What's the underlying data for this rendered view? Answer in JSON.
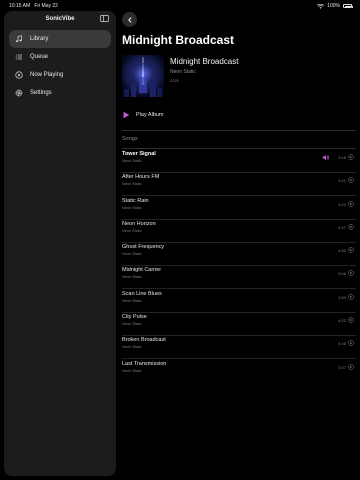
{
  "status_bar": {
    "time": "10:15 AM",
    "date": "Fri May 22",
    "battery": "100%",
    "battery_level": 1.0
  },
  "sidebar": {
    "app_title": "SonicVibe",
    "items": [
      {
        "label": "Library",
        "icon": "music-library-icon",
        "active": true
      },
      {
        "label": "Queue",
        "icon": "list-icon",
        "active": false
      },
      {
        "label": "Now Playing",
        "icon": "play-circle-icon",
        "active": false
      },
      {
        "label": "Settings",
        "icon": "gear-icon",
        "active": false
      }
    ]
  },
  "album": {
    "page_title": "Midnight Broadcast",
    "name": "Midnight Broadcast",
    "artist": "Neon Static",
    "year": "2026",
    "play_label": "Play Album"
  },
  "songs": {
    "header": "Songs",
    "accent_color": "#c65bd6",
    "items": [
      {
        "title": "Tower Signal",
        "artist": "Neon Static",
        "duration": "3:18",
        "playing": true
      },
      {
        "title": "After Hours FM",
        "artist": "Neon Static",
        "duration": "3:41",
        "playing": false
      },
      {
        "title": "Static Rain",
        "artist": "Neon Static",
        "duration": "4:04",
        "playing": false
      },
      {
        "title": "Neon Horizon",
        "artist": "Neon Static",
        "duration": "4:27",
        "playing": false
      },
      {
        "title": "Ghost Frequency",
        "artist": "Neon Static",
        "duration": "4:50",
        "playing": false
      },
      {
        "title": "Midnight Carrier",
        "artist": "Neon Static",
        "duration": "5:06",
        "playing": false
      },
      {
        "title": "Scan Line Blues",
        "artist": "Neon Static",
        "duration": "3:59",
        "playing": false
      },
      {
        "title": "City Pulse",
        "artist": "Neon Static",
        "duration": "4:22",
        "playing": false
      },
      {
        "title": "Broken Broadcast",
        "artist": "Neon Static",
        "duration": "4:45",
        "playing": false
      },
      {
        "title": "Last Transmission",
        "artist": "Neon Static",
        "duration": "3:37",
        "playing": false
      }
    ]
  }
}
